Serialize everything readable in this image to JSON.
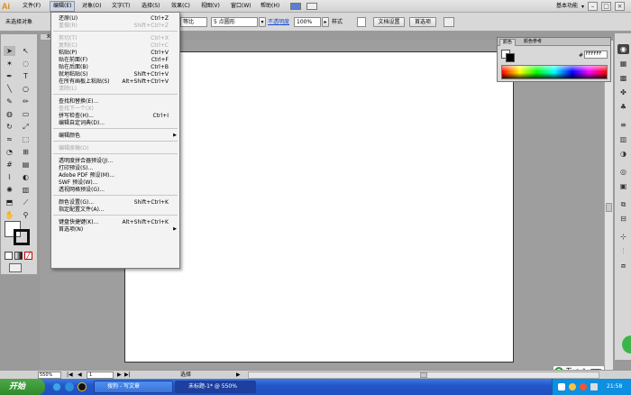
{
  "app": {
    "logo": "Ai",
    "mode": "基本功能",
    "search_icon": "search-icon"
  },
  "menubar": {
    "items": [
      "文件(F)",
      "编辑(E)",
      "对象(O)",
      "文字(T)",
      "选择(S)",
      "效果(C)",
      "视图(V)",
      "窗口(W)",
      "帮助(H)"
    ]
  },
  "control_bar": {
    "selection_label": "未选择对象",
    "stroke_profile": "等比",
    "brush": "5 点圆形",
    "opacity_label": "不透明度",
    "opacity_value": "100%",
    "style_label": "样式",
    "doc_setup": "文档设置",
    "preferences": "首选项"
  },
  "edit_menu": {
    "g1": [
      {
        "label": "还原(U)",
        "shortcut": "Ctrl+Z",
        "disabled": false
      },
      {
        "label": "重做(R)",
        "shortcut": "Shift+Ctrl+Z",
        "disabled": true
      }
    ],
    "g2": [
      {
        "label": "剪切(T)",
        "shortcut": "Ctrl+X",
        "disabled": true
      },
      {
        "label": "复制(C)",
        "shortcut": "Ctrl+C",
        "disabled": true
      },
      {
        "label": "粘贴(P)",
        "shortcut": "Ctrl+V",
        "disabled": false
      },
      {
        "label": "贴在前面(F)",
        "shortcut": "Ctrl+F",
        "disabled": false
      },
      {
        "label": "贴在后面(B)",
        "shortcut": "Ctrl+B",
        "disabled": false
      },
      {
        "label": "就地粘贴(S)",
        "shortcut": "Shift+Ctrl+V",
        "disabled": false
      },
      {
        "label": "在所有画板上粘贴(S)",
        "shortcut": "Alt+Shift+Ctrl+V",
        "disabled": false
      },
      {
        "label": "清除(L)",
        "shortcut": "",
        "disabled": true
      }
    ],
    "g3": [
      {
        "label": "查找和替换(E)...",
        "shortcut": "",
        "disabled": false
      },
      {
        "label": "查找下一个(X)",
        "shortcut": "",
        "disabled": true
      },
      {
        "label": "拼写检查(H)...",
        "shortcut": "Ctrl+I",
        "disabled": false
      },
      {
        "label": "编辑自定词典(D)...",
        "shortcut": "",
        "disabled": false
      }
    ],
    "g4": [
      {
        "label": "编辑颜色",
        "shortcut": "",
        "disabled": false,
        "submenu": true
      }
    ],
    "g5": [
      {
        "label": "编辑原稿(O)",
        "shortcut": "",
        "disabled": true
      }
    ],
    "g6": [
      {
        "label": "透明度拼合器预设(J)...",
        "shortcut": "",
        "disabled": false
      },
      {
        "label": "打印预设(S)...",
        "shortcut": "",
        "disabled": false
      },
      {
        "label": "Adobe PDF 预设(M)...",
        "shortcut": "",
        "disabled": false
      },
      {
        "label": "SWF 预设(W)...",
        "shortcut": "",
        "disabled": false
      },
      {
        "label": "透视网格预设(G)...",
        "shortcut": "",
        "disabled": false
      }
    ],
    "g7": [
      {
        "label": "颜色设置(G)...",
        "shortcut": "Shift+Ctrl+K",
        "disabled": false
      },
      {
        "label": "指定配置文件(A)...",
        "shortcut": "",
        "disabled": false
      }
    ],
    "g8": [
      {
        "label": "键盘快捷键(K)...",
        "shortcut": "Alt+Shift+Ctrl+K",
        "disabled": false
      },
      {
        "label": "首选项(N)",
        "shortcut": "",
        "disabled": false,
        "submenu": true
      }
    ]
  },
  "color_panel": {
    "tabs": [
      "颜色",
      "颜色参考"
    ],
    "hex_label": "#",
    "hex_value": "FFFFFF"
  },
  "status": {
    "zoom": "550%",
    "page": "1",
    "label": "选择"
  },
  "taskbar": {
    "start": "开始",
    "tasks": [
      "搜狗 - 写文章",
      "未标题-1* @ 550%"
    ],
    "tray_time": "21:58",
    "ime": "五"
  },
  "colors": {
    "accent_orange": "#d98c1e",
    "menu_highlight": "#cfd6e6",
    "taskbar": "#2556c8"
  }
}
